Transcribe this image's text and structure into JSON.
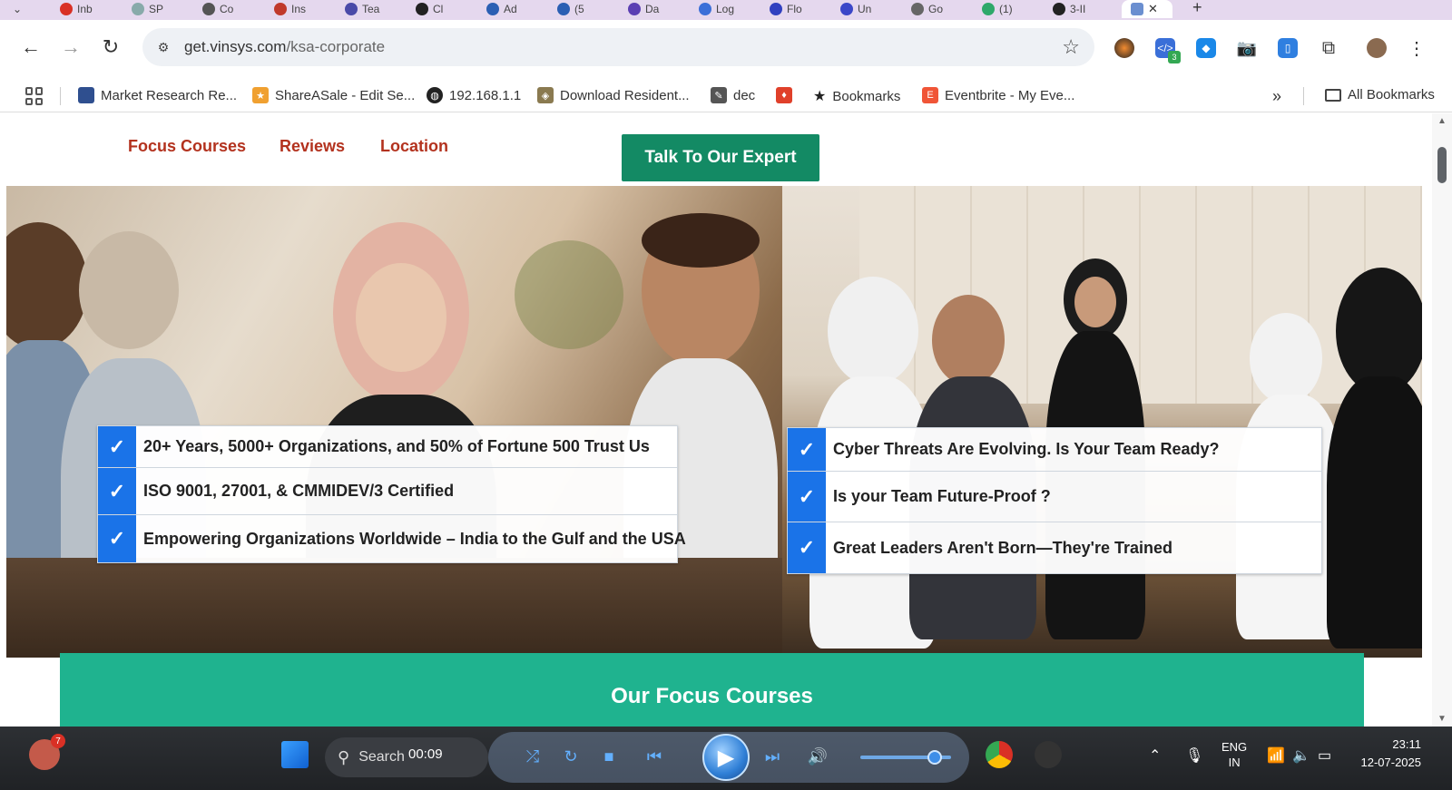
{
  "browser": {
    "tabs": [
      {
        "label": "Inb"
      },
      {
        "label": "SP"
      },
      {
        "label": "Co"
      },
      {
        "label": "Ins"
      },
      {
        "label": "Tea"
      },
      {
        "label": "Cl"
      },
      {
        "label": "Ad"
      },
      {
        "label": "(5"
      },
      {
        "label": "Da"
      },
      {
        "label": "Log"
      },
      {
        "label": "Flo"
      },
      {
        "label": "Un"
      },
      {
        "label": "Go"
      },
      {
        "label": "(1)"
      },
      {
        "label": "3-II"
      }
    ],
    "new_tab": "+",
    "url_host": "get.vinsys.com",
    "url_path": "/ksa-corporate",
    "extension_badge": "3"
  },
  "bookmarks": [
    {
      "label": "Market Research Re...",
      "color": "#2f4f8f"
    },
    {
      "label": "ShareASale - Edit Se...",
      "color": "#f0a030"
    },
    {
      "label": "192.168.1.1",
      "color": "#222222"
    },
    {
      "label": "Download Resident...",
      "color": "#8a7a50"
    },
    {
      "label": "dec",
      "color": "#555555"
    },
    {
      "label": "",
      "color": "#e0402a"
    },
    {
      "label": "Bookmarks",
      "color": "#222222"
    },
    {
      "label": "Eventbrite - My Eve...",
      "color": "#f05537"
    }
  ],
  "bookmarks_more": "»",
  "all_bookmarks": "All Bookmarks",
  "site": {
    "nav": {
      "focus_courses": "Focus Courses",
      "reviews": "Reviews",
      "location": "Location",
      "cta": "Talk To Our Expert"
    },
    "left_points": [
      "20+ Years, 5000+ Organizations, and 50% of Fortune 500 Trust Us",
      "ISO 9001, 27001, & CMMIDEV/3 Certified",
      "Empowering Organizations Worldwide – India to the Gulf and the USA"
    ],
    "right_points": [
      "Cyber Threats Are Evolving. Is Your Team Ready?",
      "Is your Team Future-Proof ?",
      "Great Leaders Aren't Born—They're Trained"
    ],
    "focus_heading": "Our Focus Courses",
    "colors": {
      "nav_link": "#b3321e",
      "cta_bg": "#138a64",
      "banner_bg": "#1fb38f",
      "check_bg": "#1a73e8"
    }
  },
  "taskbar": {
    "search_label": "Search",
    "media_time": "00:09",
    "lang_top": "ENG",
    "lang_bottom": "IN",
    "time": "23:11",
    "date": "12-07-2025",
    "notification_count": "7",
    "volume_level": 0.82
  }
}
